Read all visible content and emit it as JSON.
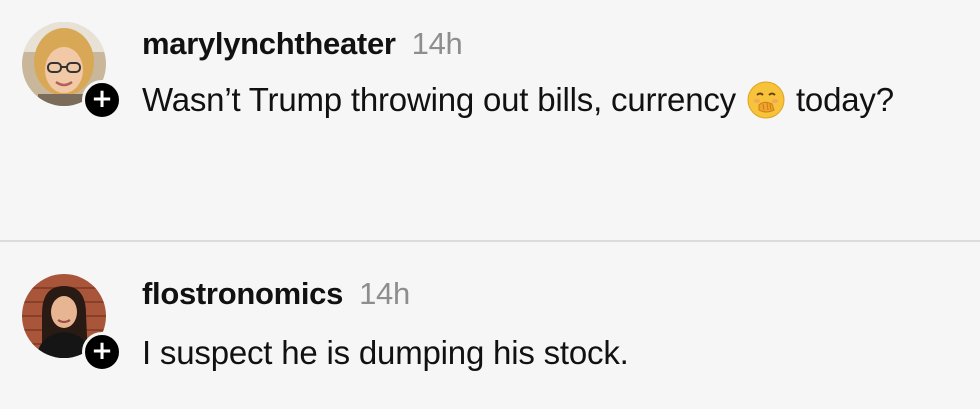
{
  "comments": [
    {
      "username": "marylynchtheater",
      "time": "14h",
      "text_before": "Wasn’t Trump throwing out bills, currency",
      "emoji": "face-with-hand-over-mouth",
      "text_after": "today?",
      "avatar_icon": "avatar-blonde-glasses",
      "badge": "+"
    },
    {
      "username": "flostronomics",
      "time": "14h",
      "text": "I suspect he is dumping his stock.",
      "avatar_icon": "avatar-dark-hair",
      "badge": "+"
    }
  ],
  "colors": {
    "background": "#f6f6f6",
    "text": "#111111",
    "timestamp": "#8e8e8e",
    "divider": "#dcdcdc",
    "badge": "#000000"
  }
}
